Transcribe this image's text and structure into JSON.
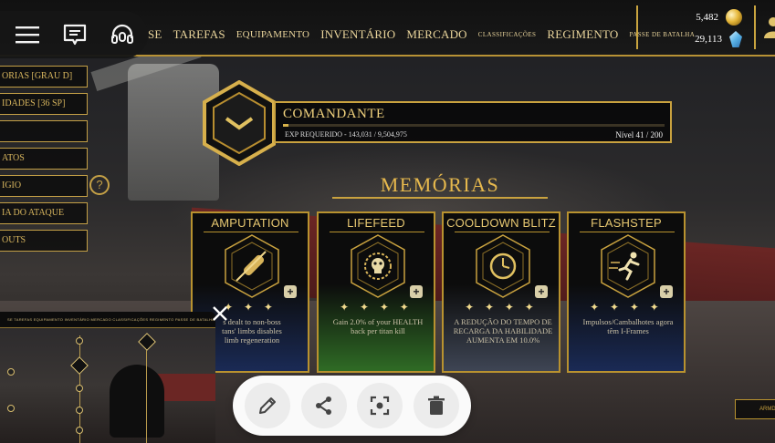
{
  "topbar": {
    "nav_items": [
      {
        "label": "SE",
        "size": "lg"
      },
      {
        "label": "TAREFAS",
        "size": "lg"
      },
      {
        "label": "EQUIPAMENTO",
        "size": "md"
      },
      {
        "label": "INVENTÁRIO",
        "size": "lg"
      },
      {
        "label": "MERCADO",
        "size": "lg"
      },
      {
        "label": "CLASSIFICAÇÕES",
        "size": "sm"
      },
      {
        "label": "REGIMENTO",
        "size": "lg"
      },
      {
        "label": "PASSE DE BATALHA",
        "size": "sm"
      }
    ],
    "gold_amount": "5,482",
    "gem_amount": "29,113"
  },
  "left_toolbar": {
    "menu_icon": "hamburger-menu-icon",
    "feedback_icon": "chat-feedback-icon",
    "headset_icon": "headset-icon"
  },
  "side_menu": {
    "items": [
      "ORIAS [GRAU D]",
      "IDADES [36 SP]",
      "",
      "ATOS",
      "IGIO",
      "IA DO ATAQUE",
      "OUTS"
    ],
    "help": "?"
  },
  "commander": {
    "name": "COMANDANTE",
    "exp_label": "EXP REQUERIDO - 143,031 / 9,504,975",
    "exp_fraction": 0.015,
    "level_label": "Nível 41 / 200"
  },
  "memories": {
    "title": "MEMÓRIAS",
    "cards": [
      {
        "name": "AMPUTATION",
        "stars": "✦ ✦ ✦",
        "desc_line1": "s dealt to non-boss",
        "desc_line2": "tans' limbs disables",
        "desc_line3": "limb regeneration",
        "icon": "scroll-sword-icon"
      },
      {
        "name": "LIFEFEED",
        "stars": "✦ ✦ ✦ ✦",
        "desc_line1": "Gain 2.0% of your HEALTH",
        "desc_line2": "back per titan kill",
        "desc_line3": "",
        "icon": "skull-sun-icon"
      },
      {
        "name": "COOLDOWN BLITZ",
        "stars": "✦ ✦ ✦ ✦",
        "desc_line1": "A REDUÇÃO DO TEMPO DE",
        "desc_line2": "RECARGA DA HABILIDADE",
        "desc_line3": "AUMENTA EM 10.0%",
        "icon": "clock-icon"
      },
      {
        "name": "FLASHSTEP",
        "stars": "✦ ✦ ✦ ✦",
        "desc_line1": "Impulsos/Cambalhotes agora",
        "desc_line2": "têm I-Frames",
        "desc_line3": "",
        "icon": "running-figure-icon"
      }
    ]
  },
  "right_button": {
    "label": "ARMD"
  },
  "thumbnail": {
    "nav_text": "SE  TAREFAS  EQUIPAMENTO  INVENTÁRIO  MERCADO  CLASSIFICAÇÕES  REGIMENTO  PASSE DE BATALHA"
  },
  "actions": {
    "edit": "pencil-icon",
    "share": "share-icon",
    "lens": "lens-scan-icon",
    "delete": "trash-icon"
  }
}
